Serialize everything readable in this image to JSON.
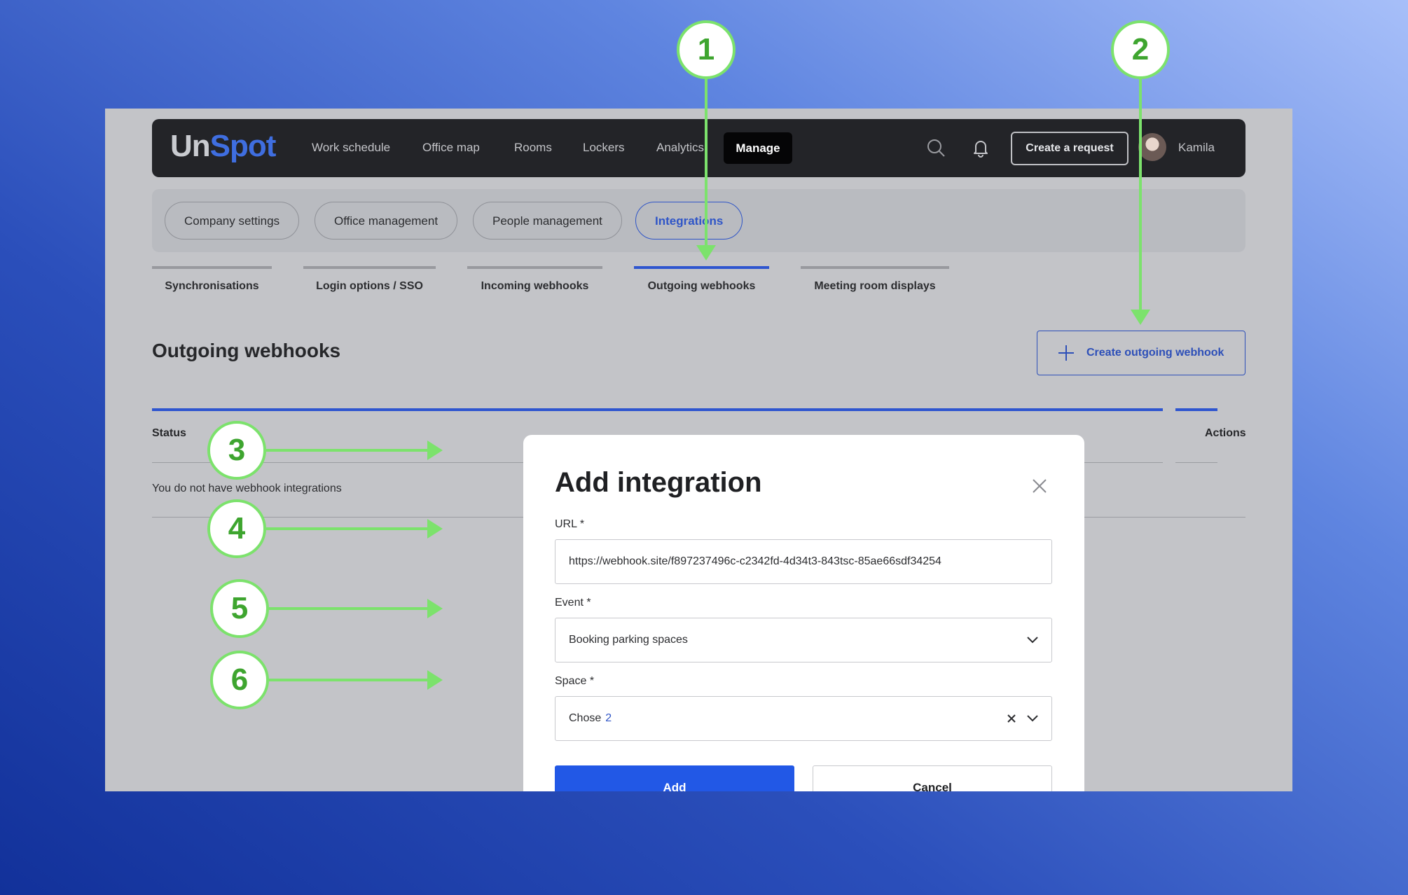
{
  "app": {
    "logo": {
      "part1": "Un",
      "part2": "Spot"
    },
    "nav": [
      "Work schedule",
      "Office map",
      "Rooms",
      "Lockers",
      "Analytics"
    ],
    "manage_label": "Manage",
    "create_request_label": "Create a request",
    "user_name": "Kamila"
  },
  "settings_tabs": [
    "Company settings",
    "Office management",
    "People management",
    "Integrations"
  ],
  "integration_tabs": [
    "Synchronisations",
    "Login options / SSO",
    "Incoming webhooks",
    "Outgoing webhooks",
    "Meeting room displays"
  ],
  "page": {
    "title": "Outgoing webhooks",
    "create_button": "Create outgoing webhook",
    "columns": {
      "status": "Status",
      "actions": "Actions"
    },
    "empty_message": "You do not have webhook integrations"
  },
  "modal": {
    "title": "Add integration",
    "url_label": "URL *",
    "url_value": "https://webhook.site/f897237496c-c2342fd-4d34t3-843tsc-85ae66sdf34254",
    "event_label": "Event *",
    "event_value": "Booking parking spaces",
    "space_label": "Space *",
    "space_value": "Chose",
    "space_count": "2",
    "add_label": "Add",
    "cancel_label": "Cancel"
  },
  "annotations": [
    "1",
    "2",
    "3",
    "4",
    "5",
    "6"
  ],
  "colors": {
    "accent": "#2258e6",
    "annotation_green": "#7ce26c",
    "navbar": "#232428"
  }
}
